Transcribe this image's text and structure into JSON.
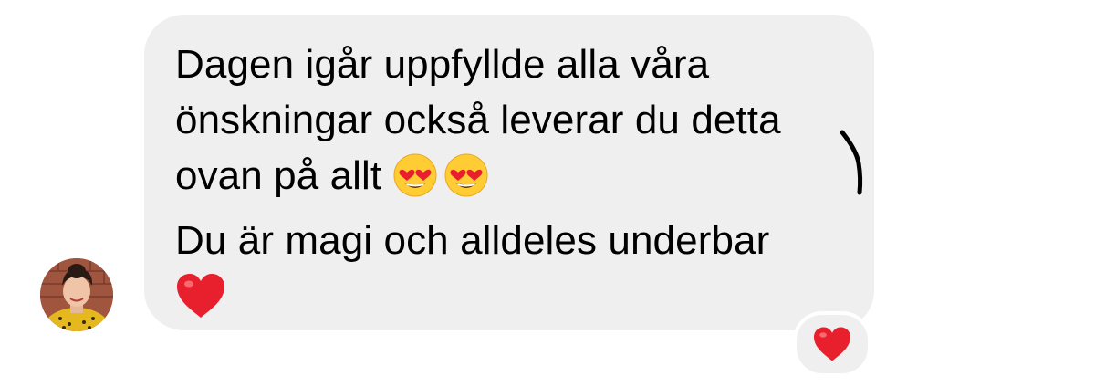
{
  "message": {
    "lines": [
      "Dagen igår uppfyllde alla våra",
      "önskningar också leverar du detta",
      "ovan på allt",
      "Du är magi och alldeles underbar"
    ],
    "inline_emojis": [
      "heart-eyes-emoji",
      "heart-eyes-emoji",
      "red-heart-emoji"
    ]
  },
  "reaction": {
    "icon": "red-heart-icon"
  },
  "colors": {
    "bubble_background": "#efefef",
    "text": "#000000",
    "heart": "#e8202e",
    "emoji_face": "#ffcc33"
  }
}
